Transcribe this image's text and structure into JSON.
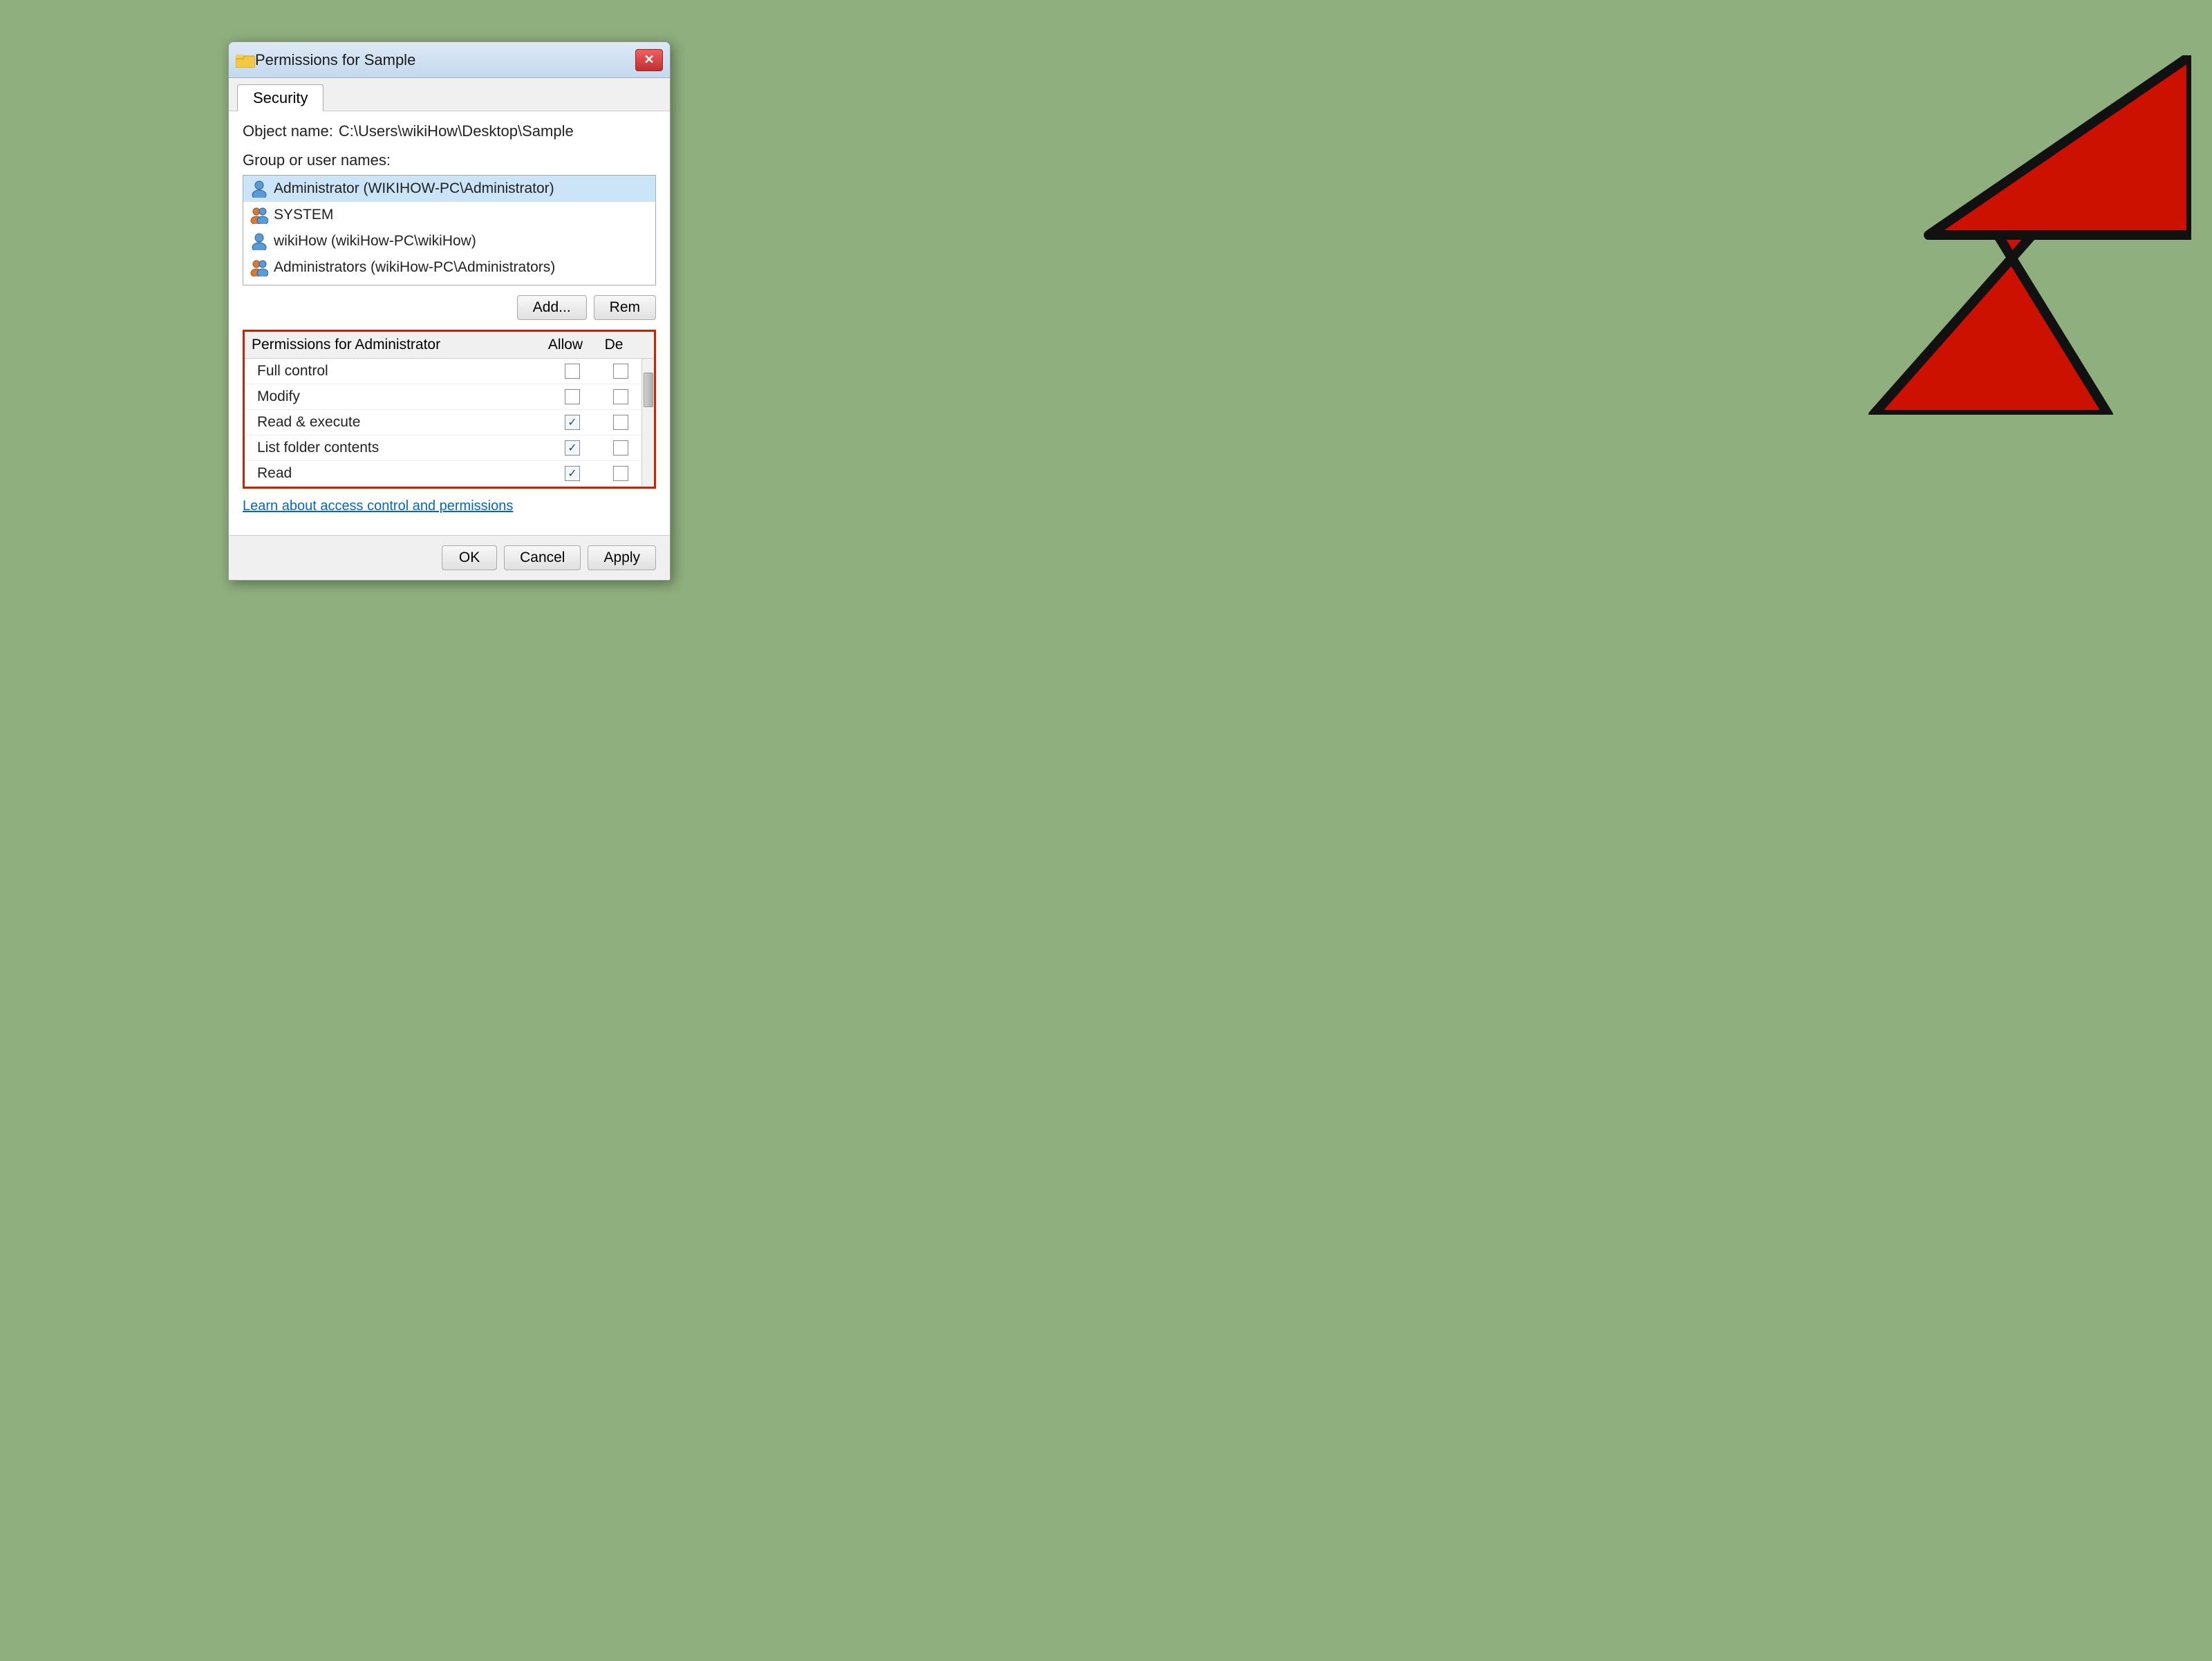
{
  "background_color": "#8faf7e",
  "dialog": {
    "title": "Permissions for Sample",
    "close_button": "✕",
    "tab": "Security",
    "object_name_label": "Object name:",
    "object_name_value": "C:\\Users\\wikiHow\\Desktop\\Sample",
    "group_label": "Group or user names:",
    "users": [
      {
        "name": "Administrator (WIKIHOW-PC\\Administrator)",
        "type": "single",
        "selected": true
      },
      {
        "name": "SYSTEM",
        "type": "group",
        "selected": false
      },
      {
        "name": "wikiHow (wikiHow-PC\\wikiHow)",
        "type": "single",
        "selected": false
      },
      {
        "name": "Administrators (wikiHow-PC\\Administrators)",
        "type": "group",
        "selected": false
      }
    ],
    "add_button": "Add...",
    "remove_button": "Rem",
    "permissions_header": "Permissions for Administrator",
    "allow_col": "Allow",
    "deny_col": "De",
    "permissions": [
      {
        "name": "Full control",
        "allow": false,
        "deny": false
      },
      {
        "name": "Modify",
        "allow": false,
        "deny": false
      },
      {
        "name": "Read & execute",
        "allow": true,
        "deny": false
      },
      {
        "name": "List folder contents",
        "allow": true,
        "deny": false
      },
      {
        "name": "Read",
        "allow": true,
        "deny": false
      }
    ],
    "learn_link": "Learn about access control and permissions",
    "ok_button": "OK",
    "cancel_button": "Cancel",
    "apply_button": "Apply"
  }
}
